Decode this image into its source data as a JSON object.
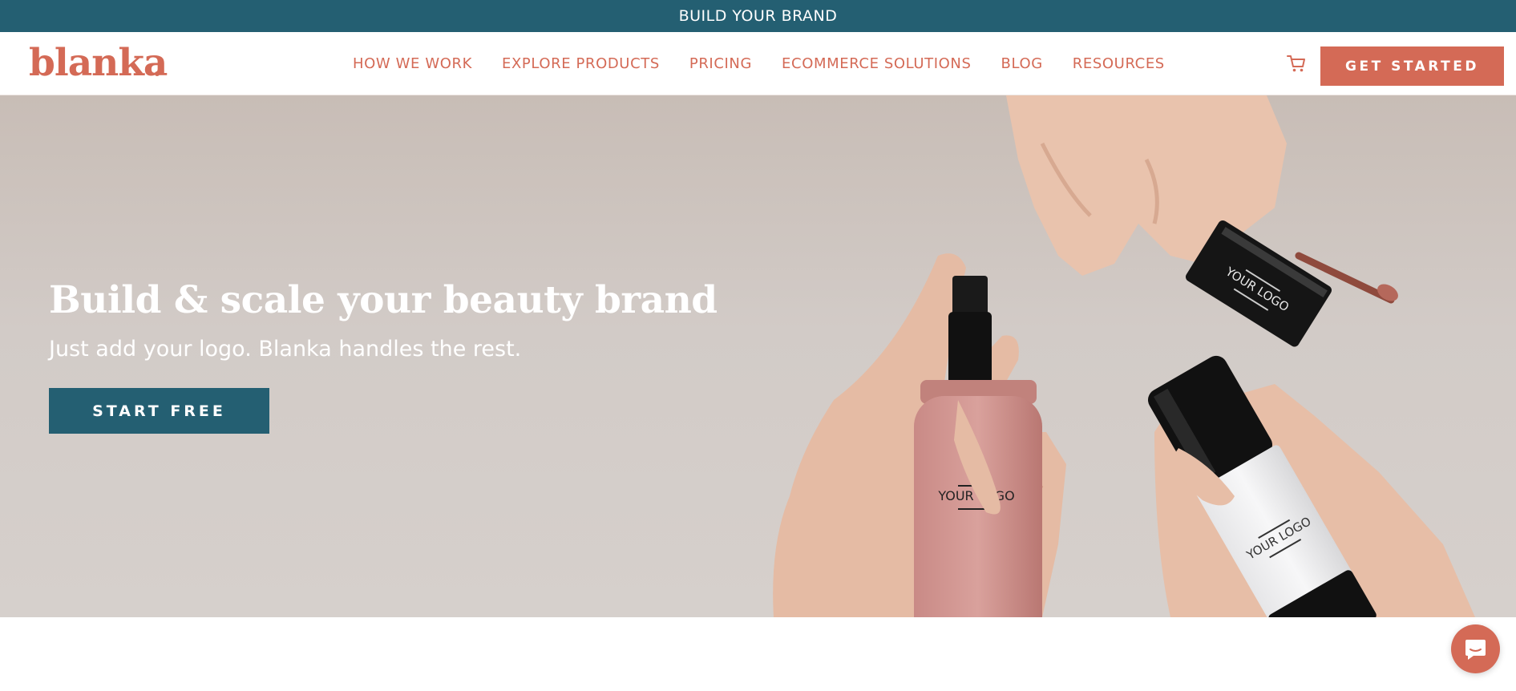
{
  "announcement": {
    "text": "BUILD YOUR BRAND"
  },
  "header": {
    "logo": "blanka",
    "nav": [
      {
        "label": "HOW WE WORK"
      },
      {
        "label": "EXPLORE PRODUCTS"
      },
      {
        "label": "PRICING"
      },
      {
        "label": "ECOMMERCE SOLUTIONS"
      },
      {
        "label": "BLOG"
      },
      {
        "label": "RESOURCES"
      }
    ],
    "cart_icon": "shopping-cart-icon",
    "cta_label": "GET STARTED"
  },
  "hero": {
    "title": "Build & scale your beauty brand",
    "subtitle": "Just add your logo. Blanka handles the rest.",
    "cta_label": "START FREE",
    "product_labels": [
      "YOUR LOGO",
      "YOUR LOGO",
      "YOUR LOGO"
    ]
  },
  "chat": {
    "icon": "chat-bubble-icon"
  },
  "colors": {
    "brand_teal": "#245f72",
    "brand_coral": "#d46a56",
    "hero_bg": "#d2cbc7"
  }
}
